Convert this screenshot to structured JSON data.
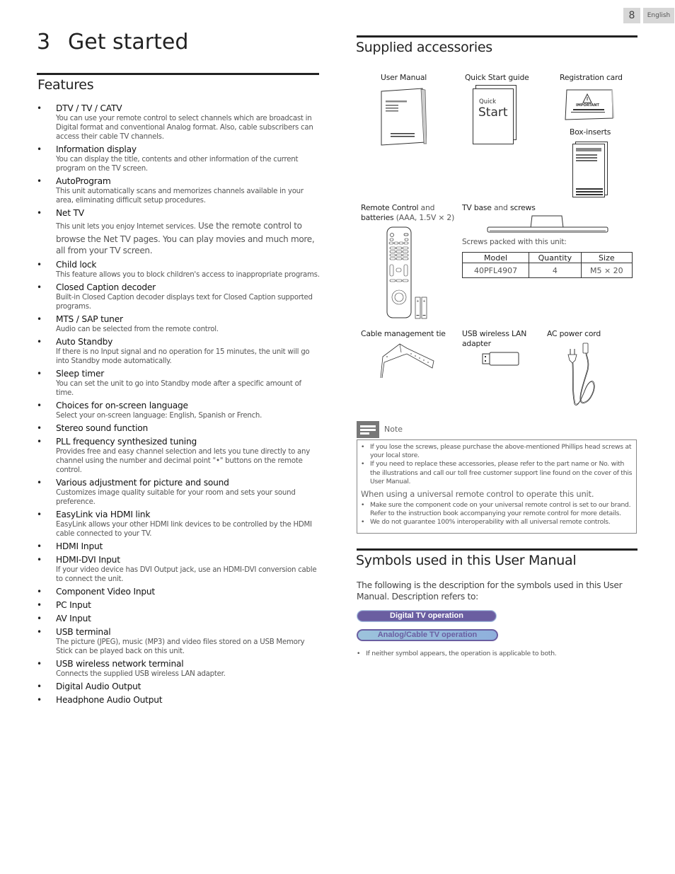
{
  "page": {
    "number": "8",
    "language": "English"
  },
  "chapter": {
    "number": "3",
    "title": "Get started"
  },
  "features": {
    "heading": "Features",
    "items": [
      {
        "title": "DTV / TV / CATV",
        "desc": "You can use your remote control to select channels which are broadcast in Digital format and conventional Analog format. Also, cable subscribers can access their cable TV channels."
      },
      {
        "title": "Information display",
        "desc": "You can display the title, contents and other information of the current program on the TV screen."
      },
      {
        "title": "AutoProgram",
        "desc": "This unit automatically scans and memorizes channels available in your area, eliminating difficult setup procedures."
      },
      {
        "title": "Net TV",
        "desc_small": "This unit lets you enjoy Internet services.",
        "desc": "Use the remote control to browse the Net TV pages. You can play movies and much more, all from your TV screen."
      },
      {
        "title": "Child lock",
        "desc": "This feature allows you to block children's access to inappropriate programs."
      },
      {
        "title": "Closed Caption decoder",
        "desc": "Built-in Closed Caption decoder displays text for Closed Caption supported programs."
      },
      {
        "title": "MTS / SAP tuner",
        "desc": "Audio can be selected from the remote control."
      },
      {
        "title": "Auto Standby",
        "desc": "If there is no Input signal and no operation for 15 minutes, the unit will go into Standby mode automatically."
      },
      {
        "title": "Sleep timer",
        "desc": "You can set the unit to go into Standby mode after a specific amount of time."
      },
      {
        "title": "Choices for on-screen language",
        "desc": "Select your on-screen language: English, Spanish or French."
      },
      {
        "title": "Stereo sound function",
        "desc": ""
      },
      {
        "title": "PLL frequency synthesized tuning",
        "desc": "Provides free and easy channel selection and lets you tune directly to any channel using the number and decimal point \"•\" buttons on the remote control."
      },
      {
        "title": "Various adjustment for picture and sound",
        "desc": "Customizes image quality suitable for your room and sets your sound preference."
      },
      {
        "title": "EasyLink via HDMI link",
        "desc": "EasyLink allows your other HDMI link devices to be controlled by the HDMI cable connected to your TV."
      },
      {
        "title": "HDMI Input",
        "desc": ""
      },
      {
        "title": "HDMI-DVI Input",
        "desc": "If your video device has DVI Output jack, use an HDMI-DVI conversion cable to connect the unit."
      },
      {
        "title": "Component Video Input",
        "desc": ""
      },
      {
        "title": "PC Input",
        "desc": ""
      },
      {
        "title": "AV Input",
        "desc": ""
      },
      {
        "title": "USB terminal",
        "desc": "The picture (JPEG), music (MP3) and video files stored on a USB Memory Stick can be played back on this unit."
      },
      {
        "title": "USB wireless network terminal",
        "desc": "Connects the supplied USB wireless LAN adapter."
      },
      {
        "title": "Digital Audio Output",
        "desc": ""
      },
      {
        "title": "Headphone Audio Output",
        "desc": ""
      }
    ]
  },
  "accessories": {
    "heading": "Supplied accessories",
    "user_manual": "User Manual",
    "quick_start": "Quick Start guide",
    "quick_start_cover_small": "Quick",
    "quick_start_cover_big": "Start",
    "registration_card": "Registration card",
    "registration_card_text": "IMPORTANT",
    "box_inserts": "Box-inserts",
    "remote_bold1": "Remote Control",
    "remote_and": " and",
    "remote_bold2": "batteries",
    "remote_spec": " (AAA, 1.5V × 2)",
    "battery_label": "AAA",
    "tv_base_bold1": "TV base",
    "tv_base_and": " and ",
    "tv_base_bold2": "screws",
    "screws_caption": "Screws packed with this unit:",
    "screws_table": {
      "headers": [
        "Model",
        "Quantity",
        "Size"
      ],
      "rows": [
        [
          "40PFL4907",
          "4",
          "M5 × 20"
        ]
      ]
    },
    "cable_tie": "Cable management tie",
    "usb_adapter_line1": "USB wireless LAN",
    "usb_adapter_line2": "adapter",
    "ac_cord": "AC power cord"
  },
  "note": {
    "title": "Note",
    "items": [
      "If you lose the screws, please purchase the above-mentioned Phillips head screws at your local store.",
      "If you need to replace these accessories, please refer to the part name or No. with the illustrations and call our toll free customer support line found on the cover of this User Manual."
    ],
    "subheading": "When using a universal remote control to operate this unit.",
    "sub_items": [
      "Make sure the component code on your universal remote control is set to our brand. Refer to the instruction book accompanying your remote control for more details.",
      "We do not guarantee 100% interoperability with all universal remote controls."
    ]
  },
  "symbols": {
    "heading": "Symbols used in this User Manual",
    "intro": "The following is the description for the symbols used in this User Manual. Description refers to:",
    "digital_badge": "Digital TV operation",
    "analog_badge": "Analog/Cable TV operation",
    "footnote": "If neither symbol appears, the operation is applicable to both."
  },
  "colors": {
    "badge_purple": "#6a5ea1",
    "badge_blue": "#9cc3dc",
    "page_tag_gray": "#d7d7d7",
    "note_icon_gray": "#777777"
  }
}
